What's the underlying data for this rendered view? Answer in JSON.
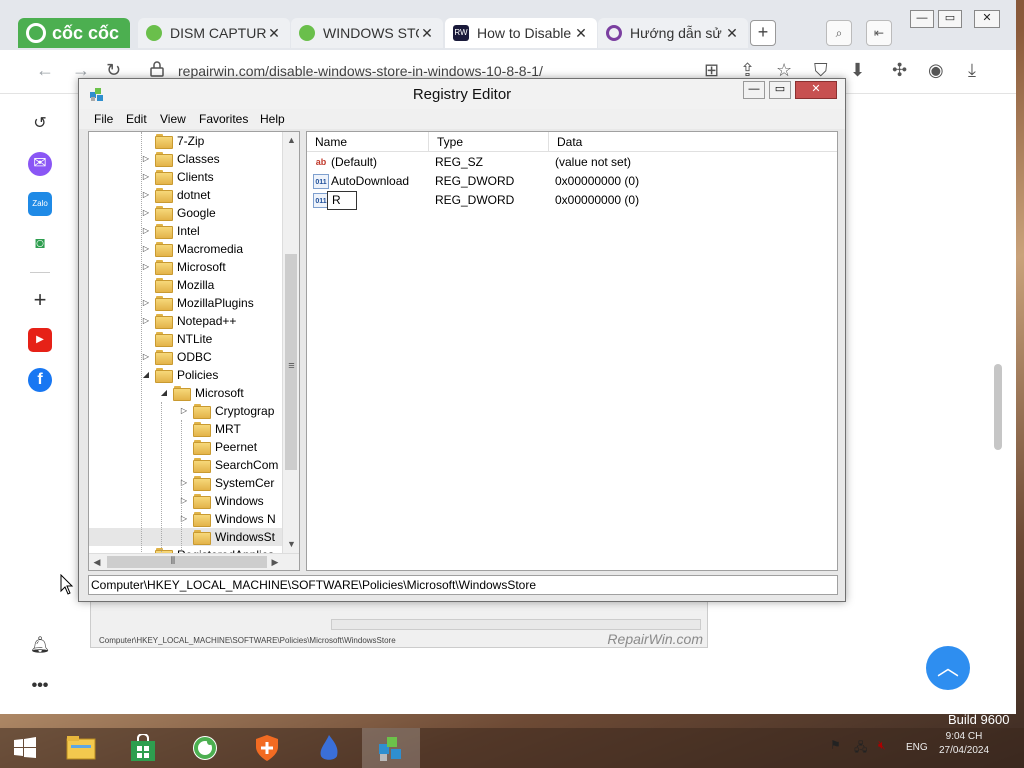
{
  "browser": {
    "brand": "cốc cốc",
    "tabs": [
      {
        "title": "DISM CAPTURE",
        "icon": "coc-coc-leaf-icon"
      },
      {
        "title": "WINDOWS STORE",
        "icon": "coc-coc-leaf-icon"
      },
      {
        "title": "How to Disable",
        "icon": "repairwin-icon",
        "active": true
      },
      {
        "title": "Hướng dẫn sử",
        "icon": "at-sign-icon"
      }
    ],
    "url": "repairwin.com/disable-windows-store-in-windows-10-8-8-1/",
    "accent_color": "#4caf50"
  },
  "article": {
    "status_path": "Computer\\HKEY_LOCAL_MACHINE\\SOFTWARE\\Policies\\Microsoft\\WindowsStore",
    "watermark": "RepairWin.com"
  },
  "regedit": {
    "title": "Registry Editor",
    "menu": [
      "File",
      "Edit",
      "View",
      "Favorites",
      "Help"
    ],
    "tree": [
      {
        "label": "7-Zip",
        "level": 0,
        "expander": ""
      },
      {
        "label": "Classes",
        "level": 0,
        "expander": "collapsed"
      },
      {
        "label": "Clients",
        "level": 0,
        "expander": "collapsed"
      },
      {
        "label": "dotnet",
        "level": 0,
        "expander": "collapsed"
      },
      {
        "label": "Google",
        "level": 0,
        "expander": "collapsed"
      },
      {
        "label": "Intel",
        "level": 0,
        "expander": "collapsed"
      },
      {
        "label": "Macromedia",
        "level": 0,
        "expander": "collapsed"
      },
      {
        "label": "Microsoft",
        "level": 0,
        "expander": "collapsed"
      },
      {
        "label": "Mozilla",
        "level": 0,
        "expander": ""
      },
      {
        "label": "MozillaPlugins",
        "level": 0,
        "expander": "collapsed"
      },
      {
        "label": "Notepad++",
        "level": 0,
        "expander": "collapsed"
      },
      {
        "label": "NTLite",
        "level": 0,
        "expander": ""
      },
      {
        "label": "ODBC",
        "level": 0,
        "expander": "collapsed"
      },
      {
        "label": "Policies",
        "level": 0,
        "expander": "expanded"
      },
      {
        "label": "Microsoft",
        "level": 1,
        "expander": "expanded"
      },
      {
        "label": "Cryptograp",
        "level": 2,
        "expander": "collapsed"
      },
      {
        "label": "MRT",
        "level": 2,
        "expander": ""
      },
      {
        "label": "Peernet",
        "level": 2,
        "expander": ""
      },
      {
        "label": "SearchCom",
        "level": 2,
        "expander": ""
      },
      {
        "label": "SystemCer",
        "level": 2,
        "expander": "collapsed"
      },
      {
        "label": "Windows",
        "level": 2,
        "expander": "collapsed"
      },
      {
        "label": "Windows N",
        "level": 2,
        "expander": "collapsed"
      },
      {
        "label": "WindowsSt",
        "level": 2,
        "expander": "",
        "selected": true
      },
      {
        "label": "RegisteredApplica",
        "level": 0,
        "expander": ""
      }
    ],
    "columns": [
      "Name",
      "Type",
      "Data"
    ],
    "values": [
      {
        "name": "(Default)",
        "type": "REG_SZ",
        "data": "(value not set)",
        "icon": "string-value-icon"
      },
      {
        "name": "AutoDownload",
        "type": "REG_DWORD",
        "data": "0x00000000 (0)",
        "icon": "dword-value-icon"
      },
      {
        "name": "R",
        "type": "REG_DWORD",
        "data": "0x00000000 (0)",
        "icon": "dword-value-icon",
        "editing": true
      }
    ],
    "status_path": "Computer\\HKEY_LOCAL_MACHINE\\SOFTWARE\\Policies\\Microsoft\\WindowsStore"
  },
  "desktop": {
    "build_text": "Build 9600",
    "clock_time": "9:04 CH",
    "clock_date": "27/04/2024",
    "language": "ENG"
  }
}
